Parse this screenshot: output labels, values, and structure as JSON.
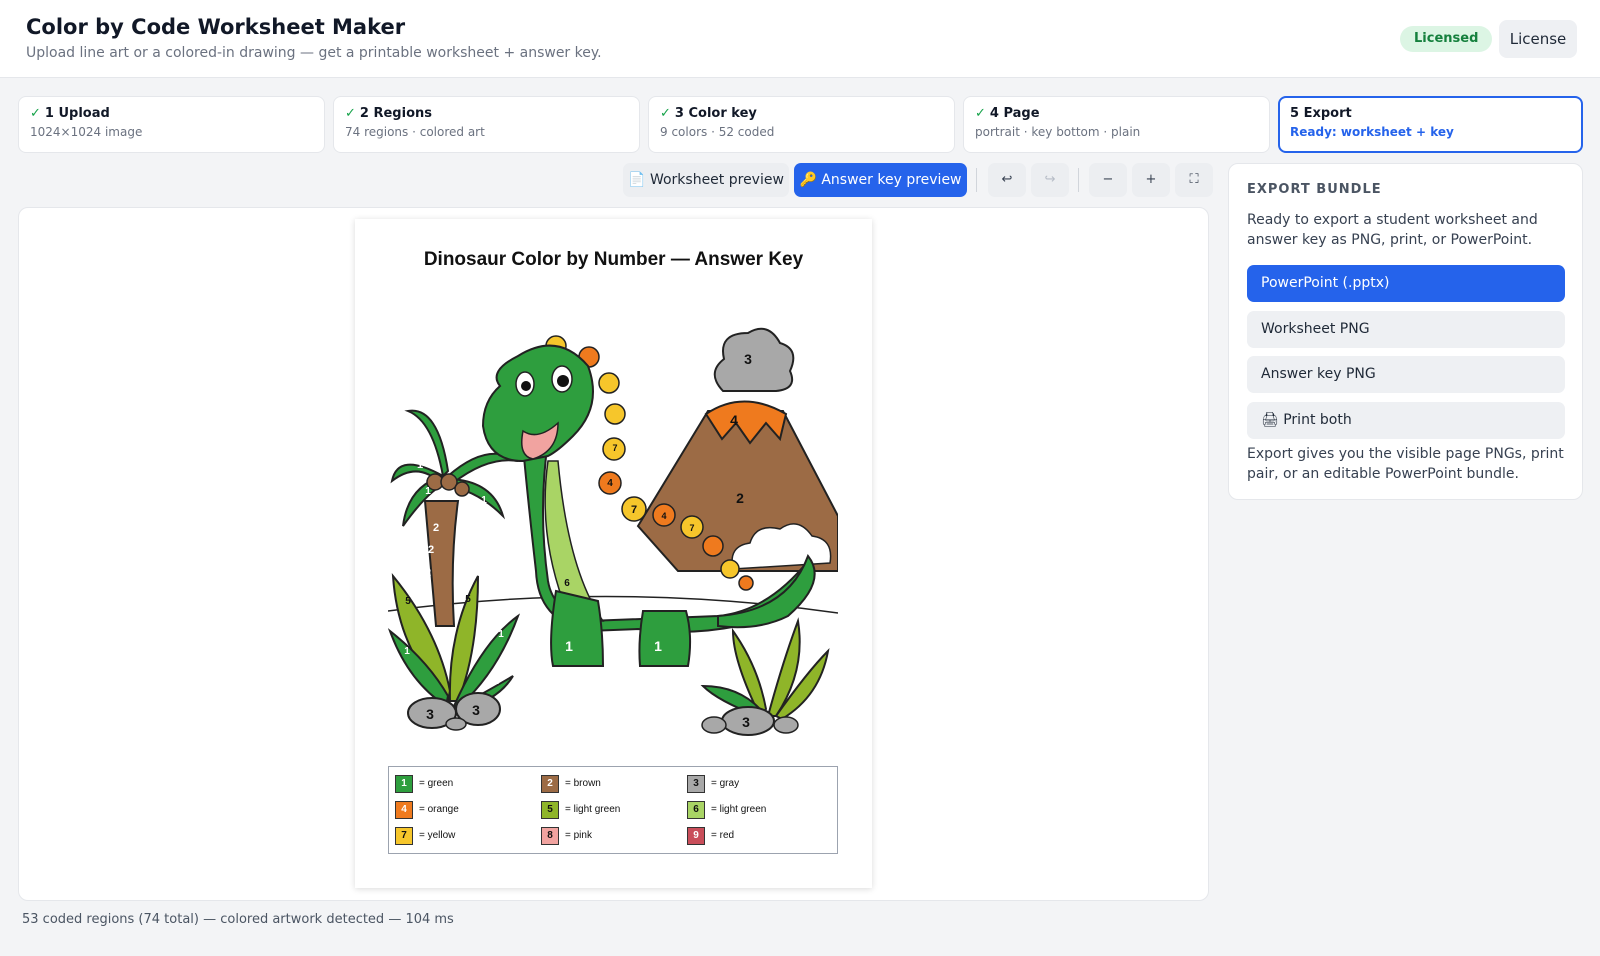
{
  "header": {
    "title": "Color by Code Worksheet Maker",
    "subtitle": "Upload line art or a colored-in drawing — get a printable worksheet + answer key.",
    "badge": "Licensed",
    "license_button": "License"
  },
  "steps": [
    {
      "check": "✓",
      "title": "1 Upload",
      "sub": "1024×1024 image"
    },
    {
      "check": "✓",
      "title": "2 Regions",
      "sub": "74 regions · colored art"
    },
    {
      "check": "✓",
      "title": "3 Color key",
      "sub": "9 colors · 52 coded"
    },
    {
      "check": "✓",
      "title": "4 Page",
      "sub": "portrait · key bottom · plain"
    },
    {
      "check": "",
      "title": "5 Export",
      "sub": "Ready: worksheet + key"
    }
  ],
  "toolbar": {
    "worksheet_preview": "📄 Worksheet preview",
    "answer_key_preview": "🔑 Answer key preview",
    "undo": "↩",
    "redo": "↪",
    "zoom_out": "−",
    "zoom_in": "+",
    "fullscreen": "⛶"
  },
  "preview": {
    "title": "Dinosaur Color by Number — Answer Key",
    "legend": [
      {
        "num": "1",
        "label": "= green",
        "color": "#2e9e3e"
      },
      {
        "num": "2",
        "label": "= brown",
        "color": "#9c6b45"
      },
      {
        "num": "3",
        "label": "= gray",
        "color": "#a8a8a8"
      },
      {
        "num": "4",
        "label": "= orange",
        "color": "#ef7a1e"
      },
      {
        "num": "5",
        "label": "= light green",
        "color": "#8fb529"
      },
      {
        "num": "6",
        "label": "= light green",
        "color": "#a9d465"
      },
      {
        "num": "7",
        "label": "= yellow",
        "color": "#f6c62b"
      },
      {
        "num": "8",
        "label": "= pink",
        "color": "#f1a3a0"
      },
      {
        "num": "9",
        "label": "= red",
        "color": "#c94e5a"
      }
    ]
  },
  "status": "53 coded regions (74 total) — colored artwork detected — 104 ms",
  "export": {
    "title": "EXPORT BUNDLE",
    "description": "Ready to export a student worksheet and answer key as PNG, print, or PowerPoint.",
    "buttons": [
      "PowerPoint (.pptx)",
      "Worksheet PNG",
      "Answer key PNG",
      "🖨 Print both"
    ],
    "note": "Export gives you the visible page PNGs, print pair, or an editable PowerPoint bundle."
  }
}
